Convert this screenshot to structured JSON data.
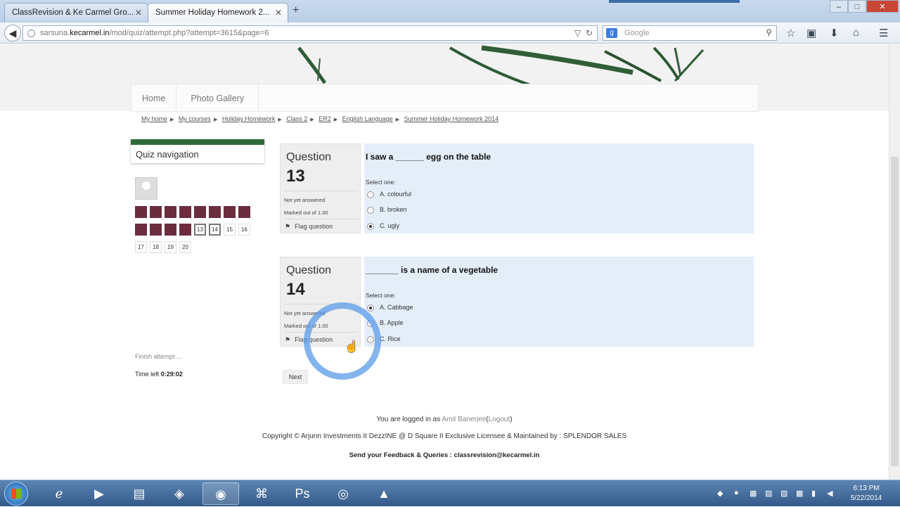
{
  "browser": {
    "tabs": [
      {
        "label": "ClassRevision & Ke Carmel Gro...",
        "active": false
      },
      {
        "label": "Summer Holiday Homework 2...",
        "active": true
      }
    ],
    "new_tab": "+",
    "url_host": "sarsuna.kecarmel.in",
    "url_prefix": "sarsuna.",
    "url_domain": "kecarmel.in",
    "url_path": "/mod/quiz/attempt.php?attempt=3615&page=6",
    "search_engine": "g",
    "search_placeholder": "Google"
  },
  "site": {
    "menu": [
      "Home",
      "Photo Gallery"
    ],
    "breadcrumb": [
      "My home",
      "My courses",
      "Holiday Homework",
      "Class 2",
      "ER2",
      "English Language",
      "Summer Holiday Homework 2014"
    ]
  },
  "quiz_nav": {
    "title": "Quiz navigation",
    "buttons": [
      {
        "n": "1",
        "state": "answered"
      },
      {
        "n": "2",
        "state": "answered"
      },
      {
        "n": "3",
        "state": "answered"
      },
      {
        "n": "4",
        "state": "answered"
      },
      {
        "n": "5",
        "state": "answered"
      },
      {
        "n": "6",
        "state": "answered"
      },
      {
        "n": "7",
        "state": "answered"
      },
      {
        "n": "8",
        "state": "answered"
      },
      {
        "n": "9",
        "state": "answered"
      },
      {
        "n": "10",
        "state": "answered"
      },
      {
        "n": "11",
        "state": "answered"
      },
      {
        "n": "12",
        "state": "answered"
      },
      {
        "n": "13",
        "state": "current"
      },
      {
        "n": "14",
        "state": "current"
      },
      {
        "n": "15",
        "state": "open"
      },
      {
        "n": "16",
        "state": "open"
      },
      {
        "n": "17",
        "state": "open"
      },
      {
        "n": "18",
        "state": "open"
      },
      {
        "n": "19",
        "state": "open"
      },
      {
        "n": "20",
        "state": "open"
      }
    ],
    "finish": "Finish attempt ...",
    "time_label": "Time left",
    "time_value": "0:29:02"
  },
  "questions": [
    {
      "label": "Question",
      "number": "13",
      "status": "Not yet answered",
      "marks": "Marked out of 1.00",
      "flag": "Flag question",
      "text": "I saw a ______ egg on the table",
      "select": "Select one:",
      "options": [
        {
          "label": "A. colourful",
          "checked": false
        },
        {
          "label": "B. broken",
          "checked": false
        },
        {
          "label": "C. ugly",
          "checked": true
        }
      ]
    },
    {
      "label": "Question",
      "number": "14",
      "status": "Not yet answered",
      "marks": "Marked out of 1.00",
      "flag": "Flag question",
      "text": "_______ is a name of a vegetable",
      "select": "Select one:",
      "options": [
        {
          "label": "A. Cabbage",
          "checked": true
        },
        {
          "label": "B. Apple",
          "checked": false
        },
        {
          "label": "C. Rice",
          "checked": false
        }
      ]
    }
  ],
  "next_button": "Next",
  "footer": {
    "logged_prefix": "You are logged in as",
    "user": "Amit Banerjee",
    "logout": "Logout",
    "copyright": "Copyright © Arjunn Investments II DezzINE @ D Square II Exclusive Licensee & Maintained by : SPLENDOR SALES",
    "feedback": "Send your Feedback & Queries : classrevision@kecarmel.in"
  },
  "taskbar": {
    "time": "6:13 PM",
    "date": "5/22/2014"
  },
  "colors": {
    "answered": "#6b2d3e",
    "block_green": "#2e6b3a",
    "question_bg": "#e4eef9",
    "taskbar": "#33598a"
  }
}
